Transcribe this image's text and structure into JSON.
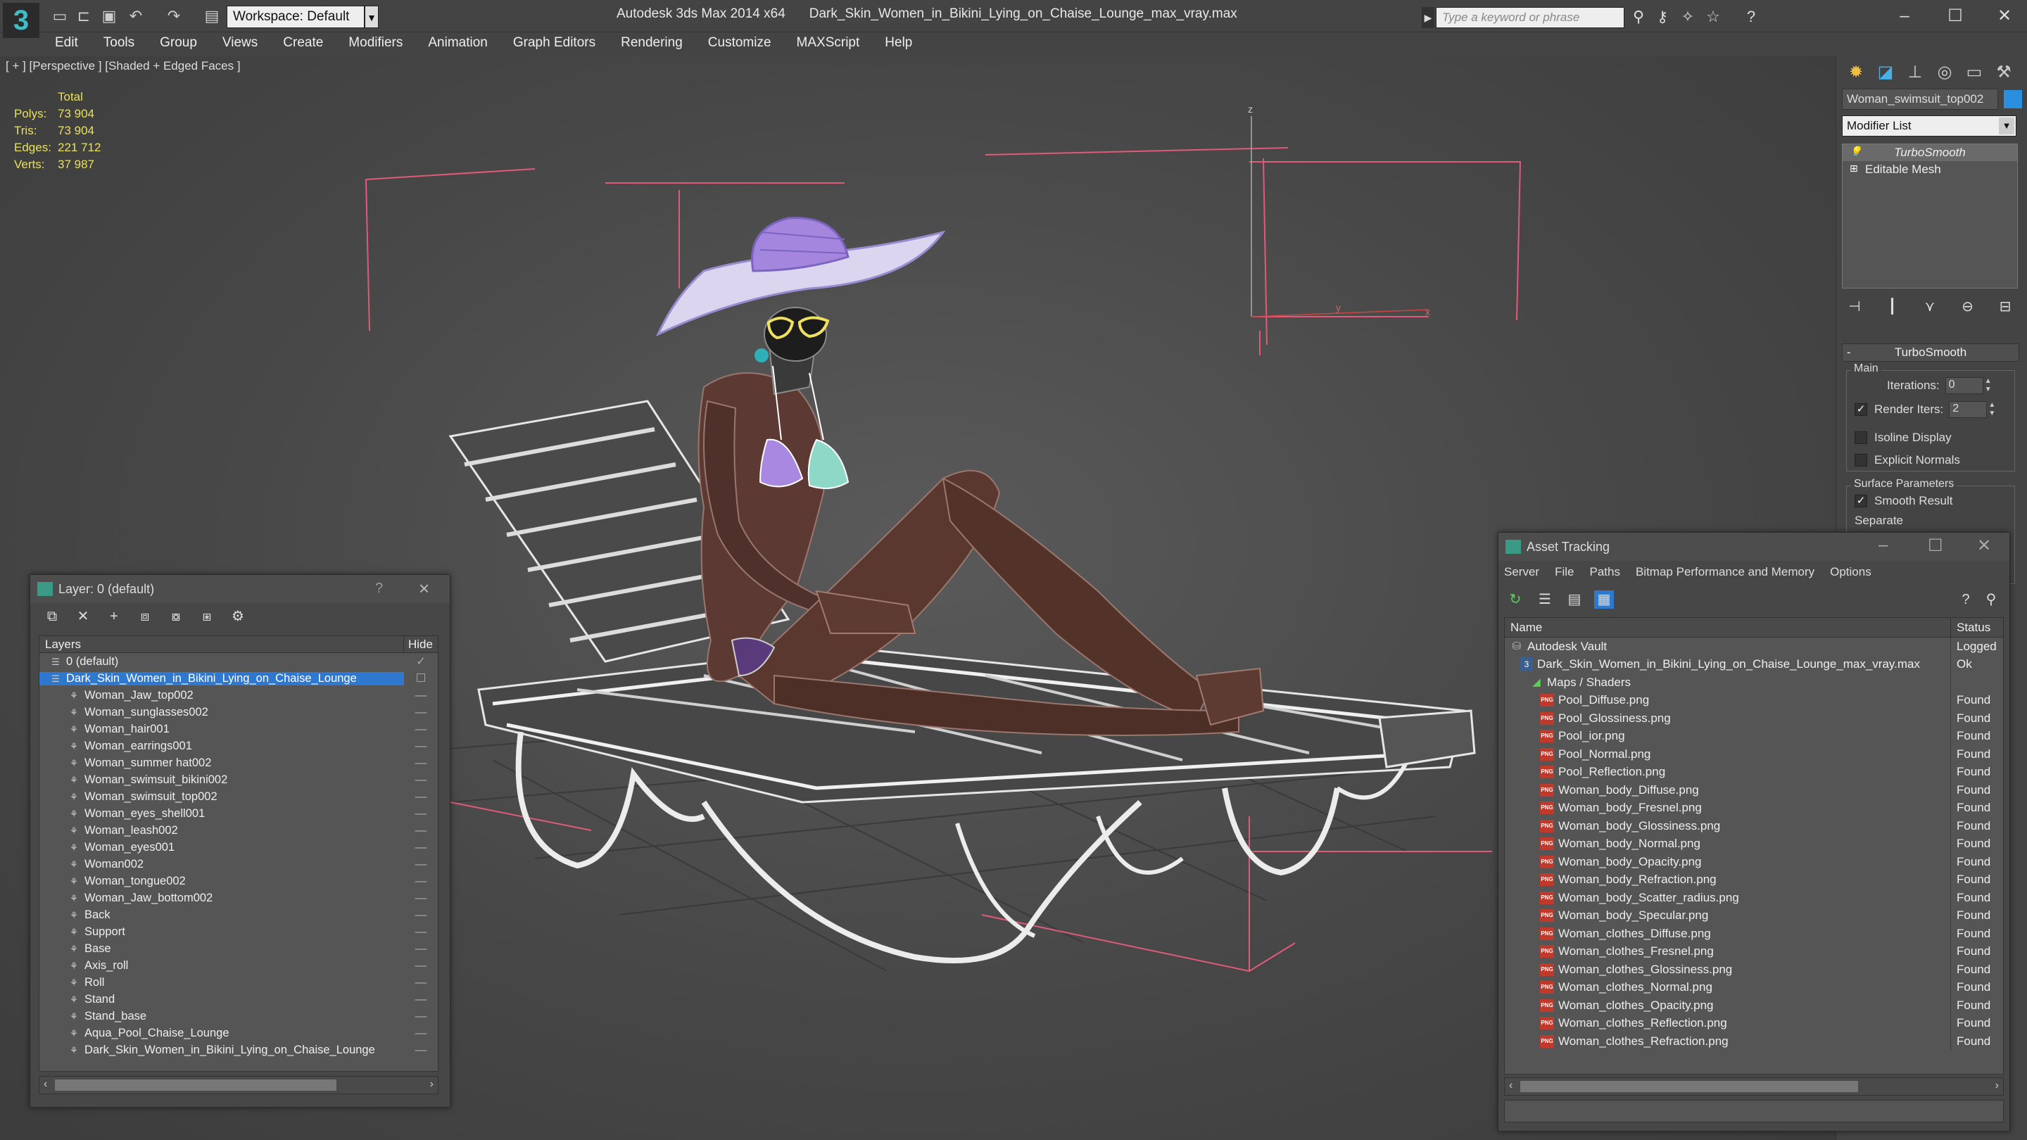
{
  "app": {
    "title": "Autodesk 3ds Max  2014 x64",
    "file": "Dark_Skin_Women_in_Bikini_Lying_on_Chaise_Lounge_max_vray.max",
    "workspace": "Workspace: Default",
    "search_placeholder": "Type a keyword or phrase"
  },
  "menu": [
    "Edit",
    "Tools",
    "Group",
    "Views",
    "Create",
    "Modifiers",
    "Animation",
    "Graph Editors",
    "Rendering",
    "Customize",
    "MAXScript",
    "Help"
  ],
  "viewport": {
    "label": "[ + ] [Perspective ] [Shaded + Edged Faces ]",
    "stats": {
      "header": "Total",
      "rows": [
        {
          "label": "Polys:",
          "value": "73 904"
        },
        {
          "label": "Tris:",
          "value": "73 904"
        },
        {
          "label": "Edges:",
          "value": "221 712"
        },
        {
          "label": "Verts:",
          "value": "37 987"
        }
      ]
    },
    "axis_z": "z",
    "axis_y": "y",
    "axis_x": "x"
  },
  "command_panel": {
    "object_name": "Woman_swimsuit_top002",
    "object_color": "#2b8fe0",
    "modifier_list": "Modifier List",
    "stack": [
      "TurboSmooth",
      "Editable Mesh"
    ],
    "rollout_title": "TurboSmooth",
    "group_main": "Main",
    "iterations_label": "Iterations:",
    "iterations_value": "0",
    "render_iters_label": "Render Iters:",
    "render_iters_value": "2",
    "isoline_label": "Isoline Display",
    "explicit_normals_label": "Explicit Normals",
    "surface_params_label": "Surface Parameters",
    "smooth_result_label": "Smooth Result",
    "separate_label": "Separate"
  },
  "layer_window": {
    "title": "Layer: 0 (default)",
    "col_layers": "Layers",
    "col_hide": "Hide",
    "rows": [
      {
        "name": "0 (default)",
        "indent": 1,
        "type": "layer"
      },
      {
        "name": "Dark_Skin_Women_in_Bikini_Lying_on_Chaise_Lounge",
        "indent": 1,
        "type": "layer",
        "selected": true
      },
      {
        "name": "Woman_Jaw_top002",
        "indent": 2
      },
      {
        "name": "Woman_sunglasses002",
        "indent": 2
      },
      {
        "name": "Woman_hair001",
        "indent": 2
      },
      {
        "name": "Woman_earrings001",
        "indent": 2
      },
      {
        "name": "Woman_summer hat002",
        "indent": 2
      },
      {
        "name": "Woman_swimsuit_bikini002",
        "indent": 2
      },
      {
        "name": "Woman_swimsuit_top002",
        "indent": 2
      },
      {
        "name": "Woman_eyes_shell001",
        "indent": 2
      },
      {
        "name": "Woman_leash002",
        "indent": 2
      },
      {
        "name": "Woman_eyes001",
        "indent": 2
      },
      {
        "name": "Woman002",
        "indent": 2
      },
      {
        "name": "Woman_tongue002",
        "indent": 2
      },
      {
        "name": "Woman_Jaw_bottom002",
        "indent": 2
      },
      {
        "name": "Back",
        "indent": 2
      },
      {
        "name": "Support",
        "indent": 2
      },
      {
        "name": "Base",
        "indent": 2
      },
      {
        "name": "Axis_roll",
        "indent": 2
      },
      {
        "name": "Roll",
        "indent": 2
      },
      {
        "name": "Stand",
        "indent": 2
      },
      {
        "name": "Stand_base",
        "indent": 2
      },
      {
        "name": "Aqua_Pool_Chaise_Lounge",
        "indent": 2
      },
      {
        "name": "Dark_Skin_Women_in_Bikini_Lying_on_Chaise_Lounge",
        "indent": 2
      }
    ]
  },
  "asset_window": {
    "title": "Asset Tracking",
    "menu": [
      "Server",
      "File",
      "Paths",
      "Bitmap Performance and Memory",
      "Options"
    ],
    "col_name": "Name",
    "col_status": "Status",
    "rows": [
      {
        "name": "Autodesk Vault",
        "status": "Logged",
        "kind": "vault",
        "indent": 1
      },
      {
        "name": "Dark_Skin_Women_in_Bikini_Lying_on_Chaise_Lounge_max_vray.max",
        "status": "Ok",
        "kind": "file",
        "indent": 2
      },
      {
        "name": "Maps / Shaders",
        "status": "",
        "kind": "folder",
        "indent": 3
      },
      {
        "name": "Pool_Diffuse.png",
        "status": "Found",
        "kind": "png",
        "indent": 4
      },
      {
        "name": "Pool_Glossiness.png",
        "status": "Found",
        "kind": "png",
        "indent": 4
      },
      {
        "name": "Pool_ior.png",
        "status": "Found",
        "kind": "png",
        "indent": 4
      },
      {
        "name": "Pool_Normal.png",
        "status": "Found",
        "kind": "png",
        "indent": 4
      },
      {
        "name": "Pool_Reflection.png",
        "status": "Found",
        "kind": "png",
        "indent": 4
      },
      {
        "name": "Woman_body_Diffuse.png",
        "status": "Found",
        "kind": "png",
        "indent": 4
      },
      {
        "name": "Woman_body_Fresnel.png",
        "status": "Found",
        "kind": "png",
        "indent": 4
      },
      {
        "name": "Woman_body_Glossiness.png",
        "status": "Found",
        "kind": "png",
        "indent": 4
      },
      {
        "name": "Woman_body_Normal.png",
        "status": "Found",
        "kind": "png",
        "indent": 4
      },
      {
        "name": "Woman_body_Opacity.png",
        "status": "Found",
        "kind": "png",
        "indent": 4
      },
      {
        "name": "Woman_body_Refraction.png",
        "status": "Found",
        "kind": "png",
        "indent": 4
      },
      {
        "name": "Woman_body_Scatter_radius.png",
        "status": "Found",
        "kind": "png",
        "indent": 4
      },
      {
        "name": "Woman_body_Specular.png",
        "status": "Found",
        "kind": "png",
        "indent": 4
      },
      {
        "name": "Woman_clothes_Diffuse.png",
        "status": "Found",
        "kind": "png",
        "indent": 4
      },
      {
        "name": "Woman_clothes_Fresnel.png",
        "status": "Found",
        "kind": "png",
        "indent": 4
      },
      {
        "name": "Woman_clothes_Glossiness.png",
        "status": "Found",
        "kind": "png",
        "indent": 4
      },
      {
        "name": "Woman_clothes_Normal.png",
        "status": "Found",
        "kind": "png",
        "indent": 4
      },
      {
        "name": "Woman_clothes_Opacity.png",
        "status": "Found",
        "kind": "png",
        "indent": 4
      },
      {
        "name": "Woman_clothes_Reflection.png",
        "status": "Found",
        "kind": "png",
        "indent": 4
      },
      {
        "name": "Woman_clothes_Refraction.png",
        "status": "Found",
        "kind": "png",
        "indent": 4
      }
    ]
  }
}
